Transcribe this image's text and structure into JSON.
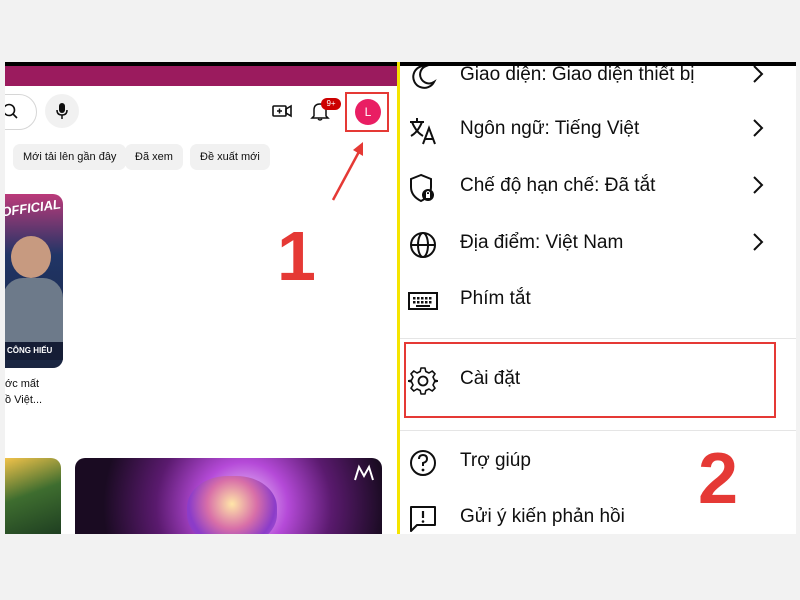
{
  "left": {
    "notification_count": "9+",
    "avatar_letter": "L",
    "chips": [
      "Mới tải lên gần đây",
      "Đã xem",
      "Đề xuất mới"
    ],
    "thumb_text_official": "OFFICIAL",
    "thumb_strip_text": "CÔNG HIẾU",
    "video_title_line1": "ớc mất",
    "video_title_line2": "ồ Việt...",
    "step_number": "1"
  },
  "menu": {
    "items": [
      {
        "label": "Giao diện: Giao diện thiết bị",
        "icon": "moon-icon",
        "has_arrow": true
      },
      {
        "label": "Ngôn ngữ: Tiếng Việt",
        "icon": "translate-icon",
        "has_arrow": true
      },
      {
        "label": "Chế độ hạn chế: Đã tắt",
        "icon": "restricted-mode-icon",
        "has_arrow": true
      },
      {
        "label": "Địa điểm: Việt Nam",
        "icon": "globe-icon",
        "has_arrow": true
      },
      {
        "label": "Phím tắt",
        "icon": "keyboard-icon",
        "has_arrow": false
      },
      {
        "label": "Cài đặt",
        "icon": "gear-icon",
        "has_arrow": false
      },
      {
        "label": "Trợ giúp",
        "icon": "help-icon",
        "has_arrow": false
      },
      {
        "label": "Gửi ý kiến phản hồi",
        "icon": "feedback-icon",
        "has_arrow": false
      }
    ],
    "step_number": "2"
  },
  "colors": {
    "highlight": "#e53935",
    "avatar": "#e91e63",
    "top_bar": "#9b1b5e",
    "divider": "#f5e400"
  }
}
